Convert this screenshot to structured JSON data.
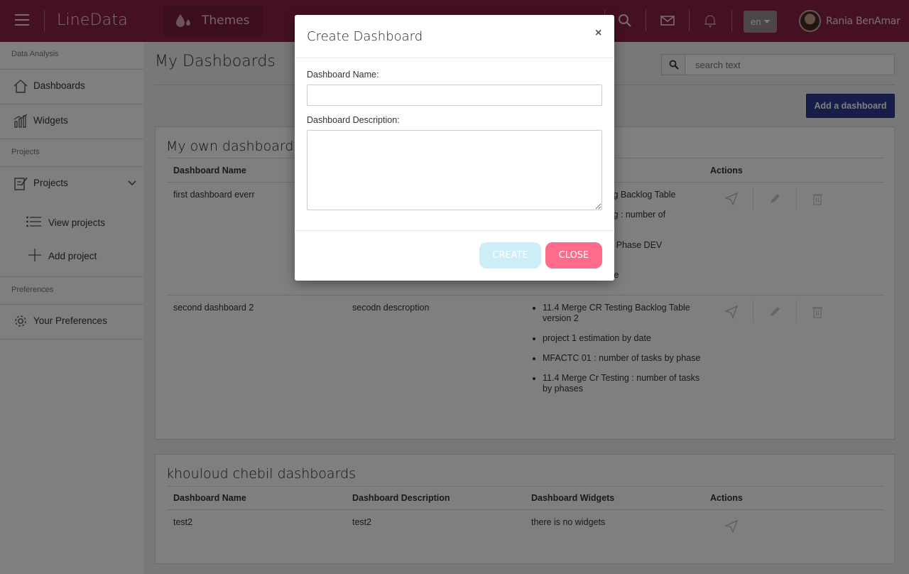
{
  "header": {
    "brand": "LineData",
    "themes_label": "Themes",
    "language": "en",
    "username": "Rania BenAmar"
  },
  "sidebar": {
    "sections": [
      "Data Analysis",
      "Projects",
      "Preferences"
    ],
    "items": [
      {
        "label": "Dashboards",
        "icon": "home-icon"
      },
      {
        "label": "Widgets",
        "icon": "bar-chart-icon"
      },
      {
        "label": "Projects",
        "icon": "edit-note-icon"
      },
      {
        "label": "View projects",
        "icon": "list-icon"
      },
      {
        "label": "Add project",
        "icon": "plus-icon"
      },
      {
        "label": "Your Preferences",
        "icon": "gear-icon"
      }
    ]
  },
  "main": {
    "title": "My Dashboards",
    "search_placeholder": "search text",
    "add_button": "Add a dashboard",
    "own_panel": {
      "title": "My own dashboards",
      "headers": [
        "Dashboard Name",
        "Actions"
      ],
      "rows": [
        {
          "name": "first dashboard everr",
          "widgets": [
            "sting Backlog Table",
            "sting : number of",
            "ting Phase DEV",
            "Time"
          ]
        },
        {
          "name": "second dashboard 2",
          "description": "secodn descroption",
          "widgets": [
            "11.4 Merge CR Testing Backlog Table version 2",
            "project 1 estimation by date",
            "MFACTC 01 : number of tasks by phase",
            "11.4 Merge Cr Testing : number of tasks by phases"
          ]
        }
      ]
    },
    "shared_panel": {
      "title": "khouloud chebil dashboards",
      "headers": [
        "Dashboard Name",
        "Dashboard Description",
        "Dashboard Widgets",
        "Actions"
      ],
      "rows": [
        {
          "name": "test2",
          "description": "test2",
          "widgets_text": "there is no widgets"
        }
      ]
    }
  },
  "modal": {
    "title": "Create Dashboard",
    "close_x": "×",
    "name_label": "Dashboard Name:",
    "name_value": "",
    "description_label": "Dashboard Description:",
    "description_value": "",
    "create_label": "CREATE",
    "close_label": "CLOSE"
  },
  "colors": {
    "topbar": "#8a2344",
    "primary_button": "#2d3d93",
    "close_button": "#ff6b8a",
    "create_button_disabled": "#cdeef6"
  }
}
